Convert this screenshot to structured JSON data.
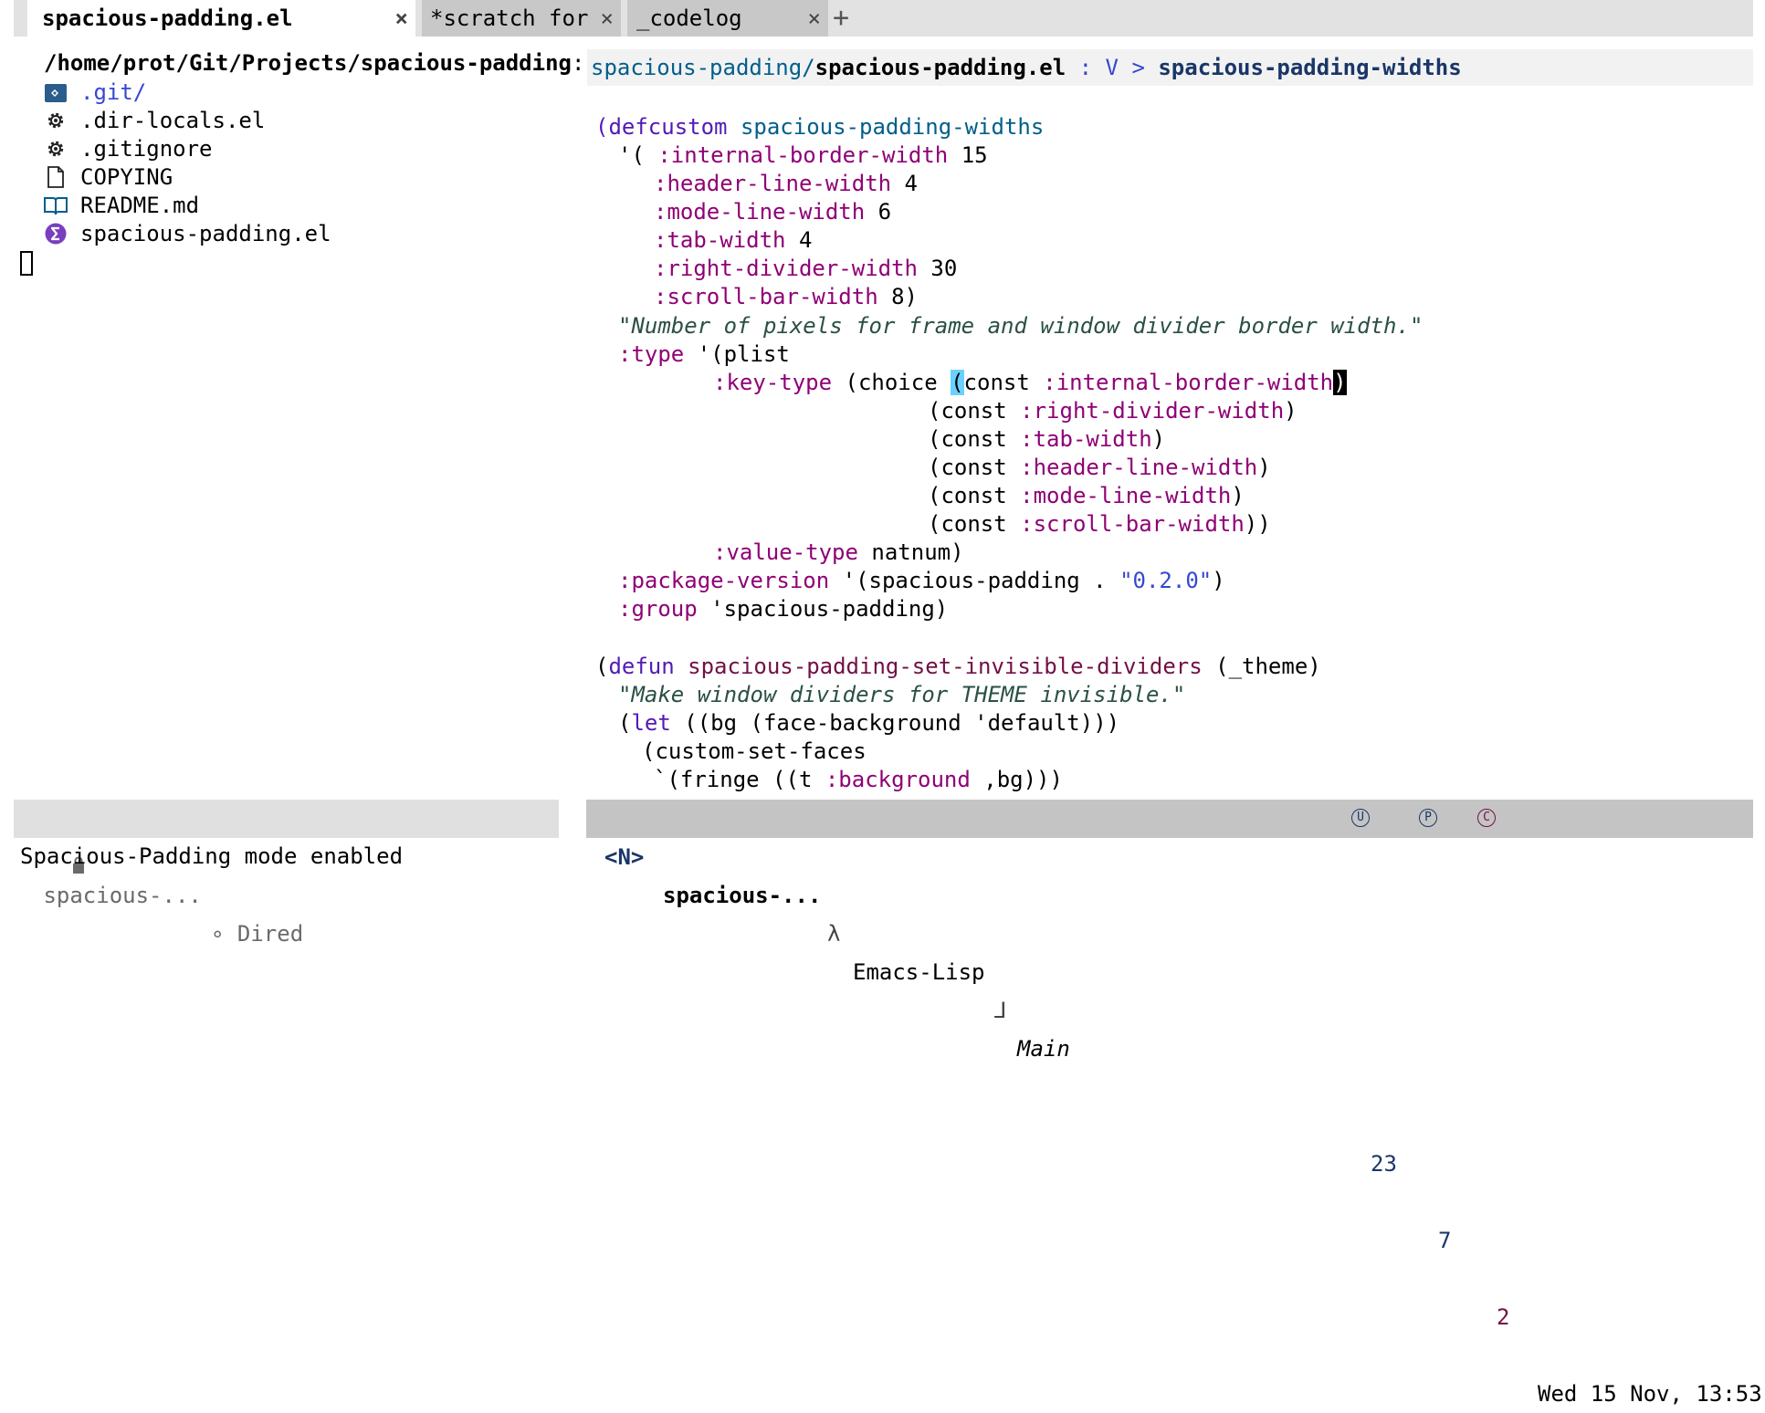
{
  "tabs": [
    {
      "label": "spacious-padding.el",
      "close": "×"
    },
    {
      "label": "*scratch for s",
      "close": "×"
    },
    {
      "label": "_codelog",
      "close": "×"
    }
  ],
  "tab_add": "+",
  "dired": {
    "header": "/home/prot/Git/Projects/spacious-padding",
    "header_colon": ":",
    "entries": [
      {
        "name": ".git/",
        "icon": "git-folder-icon"
      },
      {
        "name": ".dir-locals.el",
        "icon": "gear-icon"
      },
      {
        "name": ".gitignore",
        "icon": "gear-icon"
      },
      {
        "name": "COPYING",
        "icon": "file-icon"
      },
      {
        "name": "README.md",
        "icon": "book-icon"
      },
      {
        "name": "spacious-padding.el",
        "icon": "emacs-icon"
      }
    ]
  },
  "breadcrumb": {
    "dir": "spacious-padding/",
    "file": "spacious-padding.el",
    "sep": " : ",
    "kind": "V",
    "arrow": " > ",
    "symbol": "spacious-padding-widths"
  },
  "code": {
    "l1_kw": "(defcustom",
    "l1_name": "spacious-padding-widths",
    "l2_pre": "'( ",
    "l2_key": ":internal-border-width",
    "l2_val": " 15",
    "l3_key": ":header-line-width",
    "l3_val": " 4",
    "l4_key": ":mode-line-width",
    "l4_val": " 6",
    "l5_key": ":tab-width",
    "l5_val": " 4",
    "l6_key": ":right-divider-width",
    "l6_val": " 30",
    "l7_key": ":scroll-bar-width",
    "l7_val": " 8)",
    "l8_doc": "\"Number of pixels for frame and window divider border width.\"",
    "l9_key": ":type",
    "l9_rest": " '(plist",
    "l10_key": ":key-type",
    "l10_mid": " (choice ",
    "l10_paren": "(",
    "l10_const": "const ",
    "l10_arg": ":internal-border-width",
    "l10_close": ")",
    "l11_const": "(const ",
    "l11_arg": ":right-divider-width",
    "l11_close": ")",
    "l12_const": "(const ",
    "l12_arg": ":tab-width",
    "l12_close": ")",
    "l13_const": "(const ",
    "l13_arg": ":header-line-width",
    "l13_close": ")",
    "l14_const": "(const ",
    "l14_arg": ":mode-line-width",
    "l14_close": ")",
    "l15_const": "(const ",
    "l15_arg": ":scroll-bar-width",
    "l15_close": "))",
    "l16_key": ":value-type",
    "l16_rest": " natnum)",
    "l17_key": ":package-version",
    "l17_mid": " '(spacious-padding . ",
    "l17_str": "\"0.2.0\"",
    "l17_close": ")",
    "l18_key": ":group",
    "l18_rest": " 'spacious-padding)",
    "l20_open": "(",
    "l20_kw": "defun",
    "l20_name": " spacious-padding-set-invisible-dividers",
    "l20_rest": " (_theme)",
    "l21_doc": "\"Make window dividers for THEME invisible.\"",
    "l22_open": "(",
    "l22_kw": "let",
    "l22_rest": " ((bg (face-background 'default)))",
    "l23": "(custom-set-faces",
    "l24_pre": "`(fringe ((t ",
    "l24_key": ":background",
    "l24_rest": " ,bg)))"
  },
  "modeline_left": {
    "buffer": " spacious-...",
    "mode": "∘ Dired"
  },
  "modeline_right": {
    "state": "<N>",
    "buffer": "spacious-...",
    "mode_sym": "λ",
    "mode": "Emacs-Lisp",
    "branch_sym": "⅃",
    "branch": "Main",
    "u_count": "23",
    "p_count": "7",
    "c_count": "2",
    "datetime": "Wed 15 Nov, 13:53"
  },
  "echo": "Spacious-Padding mode enabled",
  "colors": {
    "tabbar": "#e2e2e2",
    "keyword": "#531ab6",
    "function": "#721045",
    "variable": "#005e8b",
    "builtin_keyword": "#8f0075",
    "string": "#3548cf",
    "doc": "#2a5045",
    "match_paren": "#6ad1ff"
  }
}
